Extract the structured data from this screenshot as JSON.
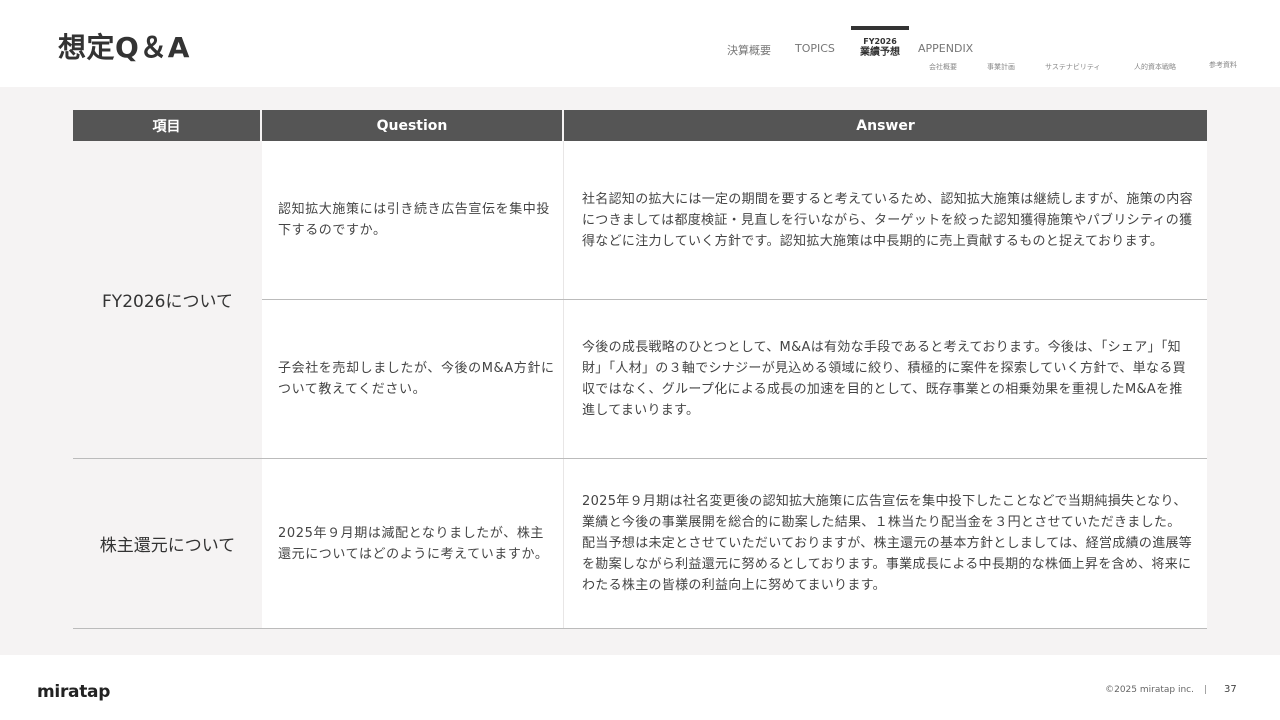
{
  "header": {
    "title": "想定Q＆A",
    "nav": [
      {
        "label": "決算概要"
      },
      {
        "label": "TOPICS"
      },
      {
        "label_small": "FY2026",
        "label_big": "業績予想",
        "active": true
      },
      {
        "label": "APPENDIX"
      }
    ],
    "subnav": [
      "会社概要",
      "事業計画",
      "サステナビリティ",
      "人的資本戦略",
      "参考資料"
    ]
  },
  "table": {
    "headers": [
      "項目",
      "Question",
      "Answer"
    ],
    "groups": [
      {
        "label": "FY2026について",
        "rows": [
          {
            "question": "認知拡大施策には引き続き広告宣伝を集中投下するのですか。",
            "answer": "社名認知の拡大には一定の期間を要すると考えているため、認知拡大施策は継続しますが、施策の内容につきましては都度検証・見直しを行いながら、ターゲットを絞った認知獲得施策やパブリシティの獲得などに注力していく方針です。認知拡大施策は中長期的に売上貢献するものと捉えております。"
          },
          {
            "question": "子会社を売却しましたが、今後のM&A方針について教えてください。",
            "answer": "今後の成長戦略のひとつとして、M&Aは有効な手段であると考えております。今後は、「シェア」「知財」「人材」の３軸でシナジーが見込める領域に絞り、積極的に案件を探索していく方針で、単なる買収ではなく、グループ化による成長の加速を目的として、既存事業との相乗効果を重視したM&Aを推進してまいります。"
          }
        ]
      },
      {
        "label": "株主還元について",
        "rows": [
          {
            "question": "2025年９月期は減配となりましたが、株主還元についてはどのように考えていますか。",
            "answer": "2025年９月期は社名変更後の認知拡大施策に広告宣伝を集中投下したことなどで当期純損失となり、業績と今後の事業展開を総合的に勘案した結果、１株当たり配当金を３円とさせていただきました。配当予想は未定とさせていただいておりますが、株主還元の基本方針としましては、経営成績の進展等を勘案しながら利益還元に努めるとしております。事業成長による中長期的な株価上昇を含め、将来にわたる株主の皆様の利益向上に努めてまいります。"
          }
        ]
      }
    ]
  },
  "footer": {
    "logo": "miratap",
    "copyright": "©2025 miratap inc.",
    "separator": "|",
    "page": "37"
  }
}
